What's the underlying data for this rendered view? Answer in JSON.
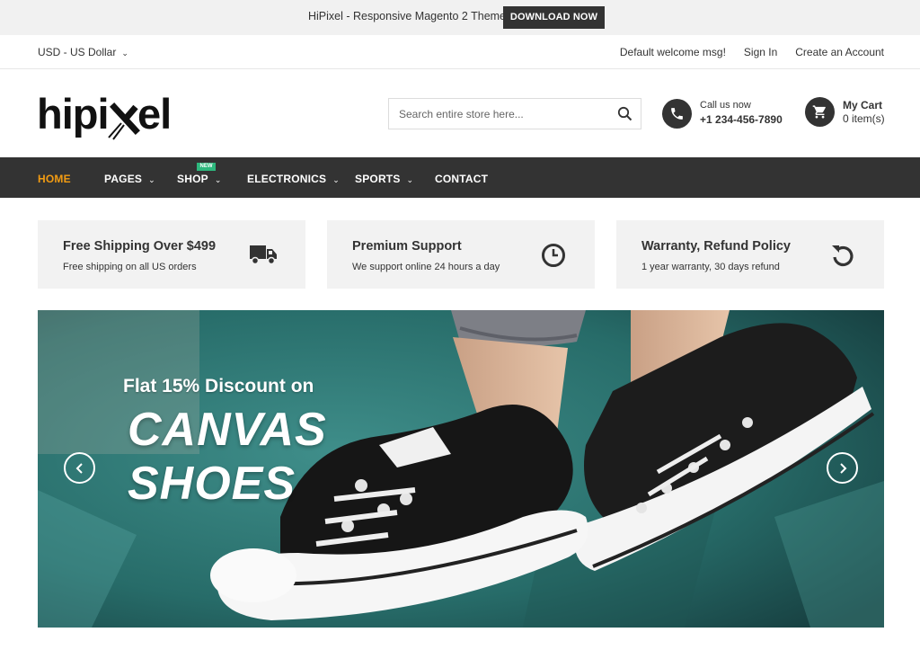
{
  "announcement": {
    "text": "HiPixel - Responsive Magento 2 Theme.",
    "button": "DOWNLOAD NOW"
  },
  "topbar": {
    "currency": "USD - US Dollar",
    "links": [
      "Default welcome msg!",
      "Sign In",
      "Create an Account"
    ]
  },
  "header": {
    "logo_text": "hipixel",
    "search_placeholder": "Search entire store here...",
    "call_label": "Call us now",
    "call_number": "+1 234-456-7890",
    "cart_title": "My Cart",
    "cart_count": "0 item(s)"
  },
  "nav": {
    "items": [
      "HOME",
      "PAGES",
      "SHOP",
      "ELECTRONICS",
      "SPORTS",
      "CONTACT"
    ],
    "badge": "NEW",
    "active_color": "#f39c12"
  },
  "features": [
    {
      "title": "Free Shipping Over $499",
      "subtitle": "Free shipping on all US orders",
      "icon": "truck-icon"
    },
    {
      "title": "Premium Support",
      "subtitle": "We support online 24 hours a day",
      "icon": "clock-icon"
    },
    {
      "title": "Warranty, Refund Policy",
      "subtitle": "1 year warranty, 30 days refund",
      "icon": "refresh-icon"
    }
  ],
  "hero": {
    "kicker": "Flat 15% Discount on",
    "line1": "CANVAS",
    "line2": "SHOES"
  },
  "colors": {
    "dark": "#333333",
    "accent": "#f39c12",
    "badge": "#2db87d",
    "panel": "#f2f2f2"
  }
}
